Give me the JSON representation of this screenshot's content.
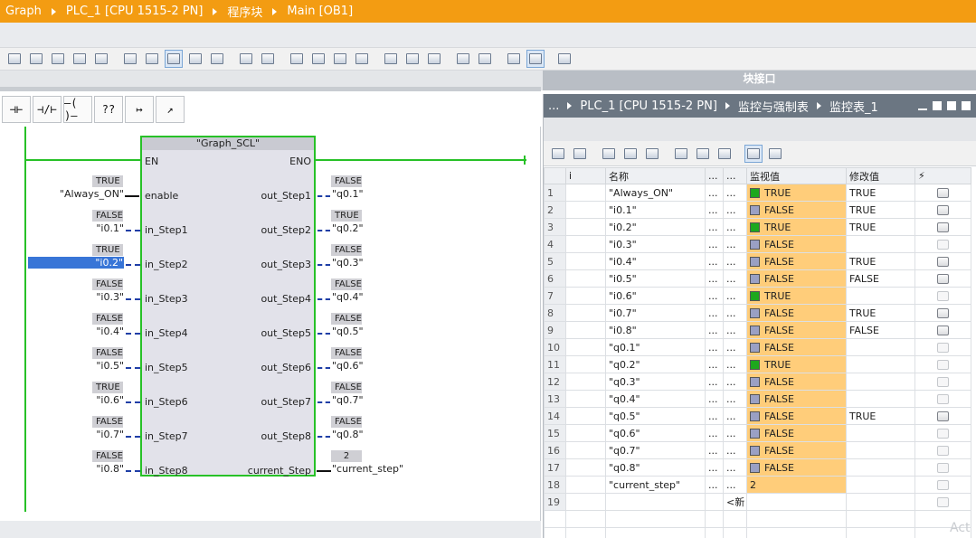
{
  "breadcrumb": [
    "Graph",
    "PLC_1 [CPU 1515-2 PN]",
    "程序块",
    "Main [OB1]"
  ],
  "block_interface_label": "块接口",
  "lad_toolbar": [
    {
      "icon": "no-contact-icon",
      "glyph": "⊣⊢"
    },
    {
      "icon": "nc-contact-icon",
      "glyph": "⊣/⊢"
    },
    {
      "icon": "coil-icon",
      "glyph": "–( )–"
    },
    {
      "icon": "empty-box-icon",
      "glyph": "??"
    },
    {
      "icon": "open-branch-icon",
      "glyph": "↦"
    },
    {
      "icon": "close-branch-icon",
      "glyph": "↗"
    }
  ],
  "function_block": {
    "title": "\"Graph_SCL\"",
    "en": "EN",
    "eno": "ENO",
    "inputs": [
      {
        "pin": "enable",
        "var": "\"Always_ON\"",
        "value": "TRUE",
        "selected": false
      },
      {
        "pin": "in_Step1",
        "var": "\"i0.1\"",
        "value": "FALSE",
        "selected": false
      },
      {
        "pin": "in_Step2",
        "var": "\"i0.2\"",
        "value": "TRUE",
        "selected": true
      },
      {
        "pin": "in_Step3",
        "var": "\"i0.3\"",
        "value": "FALSE",
        "selected": false
      },
      {
        "pin": "in_Step4",
        "var": "\"i0.4\"",
        "value": "FALSE",
        "selected": false
      },
      {
        "pin": "in_Step5",
        "var": "\"i0.5\"",
        "value": "FALSE",
        "selected": false
      },
      {
        "pin": "in_Step6",
        "var": "\"i0.6\"",
        "value": "TRUE",
        "selected": false
      },
      {
        "pin": "in_Step7",
        "var": "\"i0.7\"",
        "value": "FALSE",
        "selected": false
      },
      {
        "pin": "in_Step8",
        "var": "\"i0.8\"",
        "value": "FALSE",
        "selected": false
      }
    ],
    "outputs": [
      {
        "pin": "out_Step1",
        "var": "\"q0.1\"",
        "value": "FALSE"
      },
      {
        "pin": "out_Step2",
        "var": "\"q0.2\"",
        "value": "TRUE"
      },
      {
        "pin": "out_Step3",
        "var": "\"q0.3\"",
        "value": "FALSE"
      },
      {
        "pin": "out_Step4",
        "var": "\"q0.4\"",
        "value": "FALSE"
      },
      {
        "pin": "out_Step5",
        "var": "\"q0.5\"",
        "value": "FALSE"
      },
      {
        "pin": "out_Step6",
        "var": "\"q0.6\"",
        "value": "FALSE"
      },
      {
        "pin": "out_Step7",
        "var": "\"q0.7\"",
        "value": "FALSE"
      },
      {
        "pin": "out_Step8",
        "var": "\"q0.8\"",
        "value": "FALSE"
      },
      {
        "pin": "current_Step",
        "var": "\"current_step\"",
        "value": "2"
      }
    ]
  },
  "watch_panel": {
    "breadcrumb": [
      "...",
      "PLC_1 [CPU 1515-2 PN]",
      "监控与强制表",
      "监控表_1"
    ],
    "columns": [
      "",
      "i",
      "名称",
      "...",
      "...",
      "监视值",
      "修改值",
      "⚡"
    ],
    "rows": [
      {
        "n": "1",
        "name": "\"Always_ON\"",
        "led": "on",
        "mon": "TRUE",
        "mod": "TRUE"
      },
      {
        "n": "2",
        "name": "\"i0.1\"",
        "led": "off",
        "mon": "FALSE",
        "mod": "TRUE"
      },
      {
        "n": "3",
        "name": "\"i0.2\"",
        "led": "on",
        "mon": "TRUE",
        "mod": "TRUE"
      },
      {
        "n": "4",
        "name": "\"i0.3\"",
        "led": "off",
        "mon": "FALSE",
        "mod": ""
      },
      {
        "n": "5",
        "name": "\"i0.4\"",
        "led": "off",
        "mon": "FALSE",
        "mod": "TRUE"
      },
      {
        "n": "6",
        "name": "\"i0.5\"",
        "led": "off",
        "mon": "FALSE",
        "mod": "FALSE"
      },
      {
        "n": "7",
        "name": "\"i0.6\"",
        "led": "on",
        "mon": "TRUE",
        "mod": ""
      },
      {
        "n": "8",
        "name": "\"i0.7\"",
        "led": "off",
        "mon": "FALSE",
        "mod": "TRUE"
      },
      {
        "n": "9",
        "name": "\"i0.8\"",
        "led": "off",
        "mon": "FALSE",
        "mod": "FALSE"
      },
      {
        "n": "10",
        "name": "\"q0.1\"",
        "led": "off",
        "mon": "FALSE",
        "mod": ""
      },
      {
        "n": "11",
        "name": "\"q0.2\"",
        "led": "on",
        "mon": "TRUE",
        "mod": ""
      },
      {
        "n": "12",
        "name": "\"q0.3\"",
        "led": "off",
        "mon": "FALSE",
        "mod": ""
      },
      {
        "n": "13",
        "name": "\"q0.4\"",
        "led": "off",
        "mon": "FALSE",
        "mod": ""
      },
      {
        "n": "14",
        "name": "\"q0.5\"",
        "led": "off",
        "mon": "FALSE",
        "mod": "TRUE"
      },
      {
        "n": "15",
        "name": "\"q0.6\"",
        "led": "off",
        "mon": "FALSE",
        "mod": ""
      },
      {
        "n": "16",
        "name": "\"q0.7\"",
        "led": "off",
        "mon": "FALSE",
        "mod": ""
      },
      {
        "n": "17",
        "name": "\"q0.8\"",
        "led": "off",
        "mon": "FALSE",
        "mod": ""
      },
      {
        "n": "18",
        "name": "\"current_step\"",
        "led": "",
        "mon": "2",
        "mod": ""
      },
      {
        "n": "19",
        "name": "",
        "led": "",
        "mon": "",
        "mod": "",
        "add": "<新"
      }
    ]
  },
  "watermark": "Act",
  "colors": {
    "accent": "#f39c12",
    "rail": "#27c127",
    "monitor": "#ffcd7a",
    "selected": "#3875d7"
  }
}
